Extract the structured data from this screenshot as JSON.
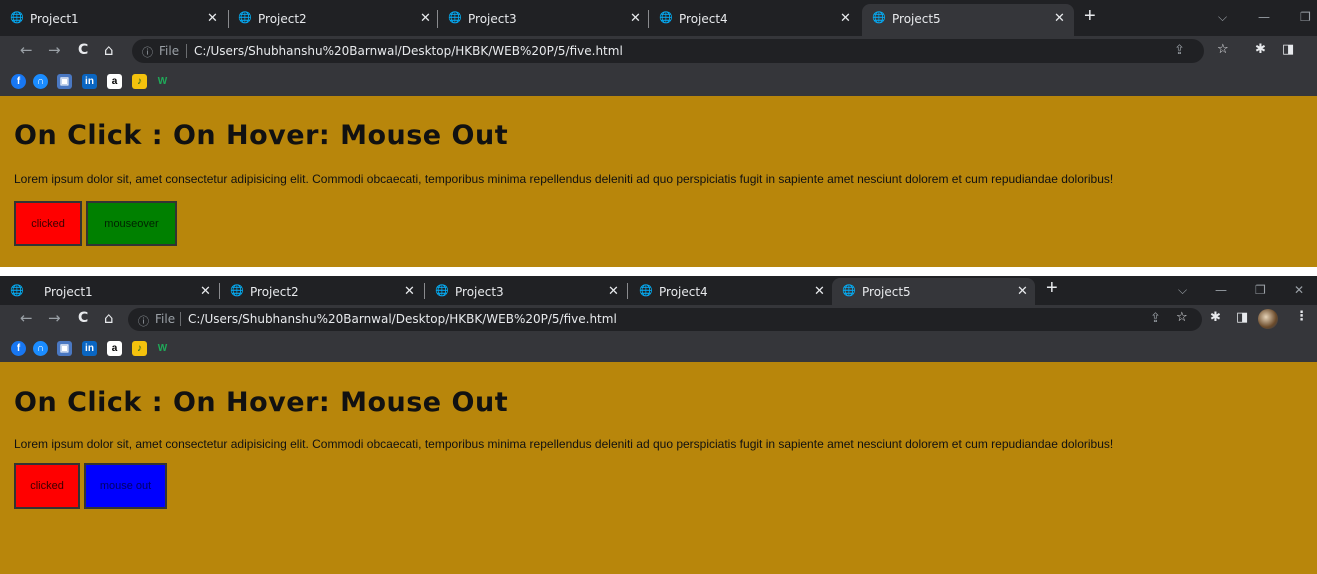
{
  "windows": [
    {
      "tabs": [
        {
          "label": "Project1"
        },
        {
          "label": "Project2"
        },
        {
          "label": "Project3"
        },
        {
          "label": "Project4"
        },
        {
          "label": "Project5",
          "active": true
        }
      ],
      "address": {
        "info_icon": "ⓘ",
        "scheme_label": "File",
        "url": "C:/Users/Shubhanshu%20Barnwal/Desktop/HKBK/WEB%20P/5/five.html"
      },
      "page": {
        "heading": "On Click : On Hover: Mouse Out",
        "paragraph": "Lorem ipsum dolor sit, amet consectetur adipisicing elit. Commodi obcaecati, temporibus minima repellendus deleniti ad quo perspiciatis fugit in sapiente amet nesciunt dolorem et cum repudiandae doloribus!",
        "buttons": [
          {
            "label": "clicked",
            "color": "#ff0000"
          },
          {
            "label": "mouseover",
            "color": "#008000"
          }
        ]
      }
    },
    {
      "tabs": [
        {
          "label": "Project1"
        },
        {
          "label": "Project2"
        },
        {
          "label": "Project3"
        },
        {
          "label": "Project4"
        },
        {
          "label": "Project5",
          "active": true
        }
      ],
      "address": {
        "info_icon": "ⓘ",
        "scheme_label": "File",
        "url": "C:/Users/Shubhanshu%20Barnwal/Desktop/HKBK/WEB%20P/5/five.html"
      },
      "page": {
        "heading": "On Click : On Hover: Mouse Out",
        "paragraph": "Lorem ipsum dolor sit, amet consectetur adipisicing elit. Commodi obcaecati, temporibus minima repellendus deleniti ad quo perspiciatis fugit in sapiente amet nesciunt dolorem et cum repudiandae doloribus!",
        "buttons": [
          {
            "label": "clicked",
            "color": "#ff0000"
          },
          {
            "label": "mouse out",
            "color": "#0000ff"
          }
        ]
      }
    }
  ],
  "bookmarks": [
    {
      "name": "facebook-icon",
      "color": "#1877f2",
      "glyph": "f"
    },
    {
      "name": "headphones-icon",
      "color": "#1a8cff",
      "glyph": "∩"
    },
    {
      "name": "photo-app-icon",
      "color": "#4a78c2",
      "glyph": "▣"
    },
    {
      "name": "linkedin-icon",
      "color": "#0a66c2",
      "glyph": "in"
    },
    {
      "name": "amazon-icon",
      "color": "#ffffff",
      "glyph": "a"
    },
    {
      "name": "music-app-icon",
      "color": "#f4c20d",
      "glyph": "♪"
    },
    {
      "name": "w-app-icon",
      "color": "#35363a",
      "glyph": "W"
    }
  ],
  "colors": {
    "page_bg": "#b8860b",
    "tabstrip_bg": "#202124",
    "toolbar_bg": "#35363a"
  },
  "icons": {
    "globe": "🌐",
    "close": "✕",
    "new_tab": "+",
    "back": "←",
    "forward": "→",
    "reload": "C",
    "home": "⌂",
    "share": "⇪",
    "star": "☆",
    "extensions": "✱",
    "sidepanel": "◨",
    "menu": "⋮",
    "chevron": "⌵",
    "minimize": "—",
    "maximize": "❐",
    "window_close": "✕"
  }
}
